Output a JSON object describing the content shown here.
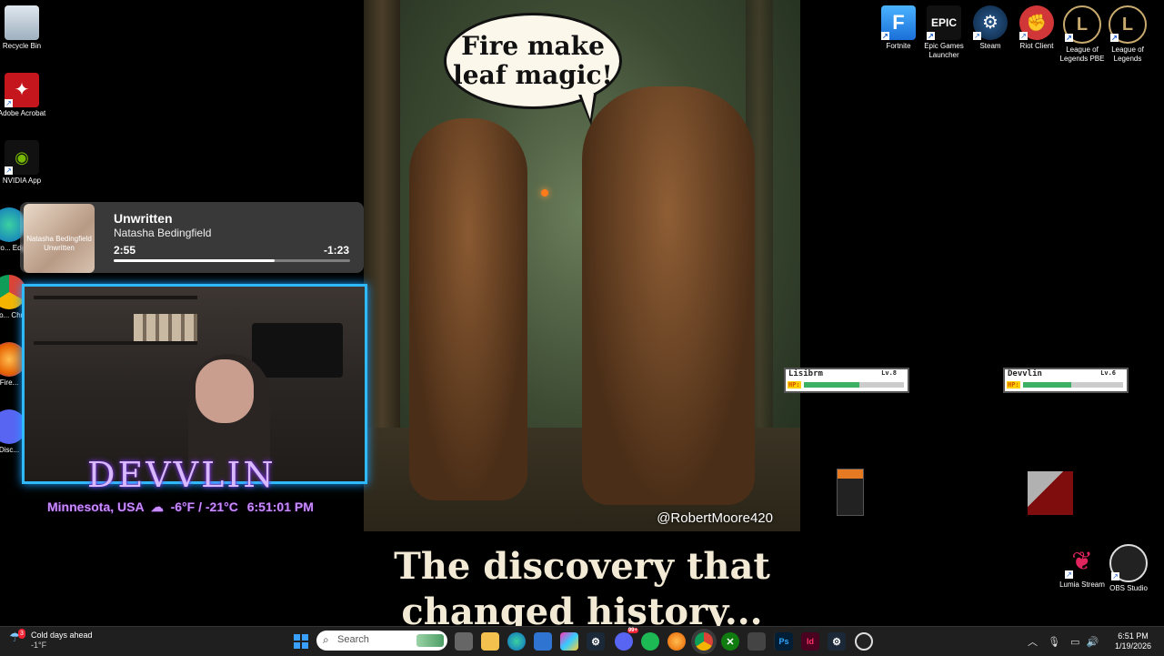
{
  "desktop_left": [
    {
      "label": "Recycle Bin"
    },
    {
      "label": "Adobe Acrobat"
    },
    {
      "label": "NVIDIA App"
    },
    {
      "label": "Micro... Edg..."
    },
    {
      "label": "Goo... Chr..."
    },
    {
      "label": "Fire..."
    },
    {
      "label": "Disc..."
    }
  ],
  "desktop_right": [
    {
      "label": "Fortnite",
      "glyph": "F"
    },
    {
      "label": "Epic Games Launcher",
      "glyph": "EPIC"
    },
    {
      "label": "Steam",
      "glyph": "⚙"
    },
    {
      "label": "Riot Client",
      "glyph": "✊"
    },
    {
      "label": "League of Legends PBE",
      "glyph": "L"
    },
    {
      "label": "League of Legends",
      "glyph": "L"
    }
  ],
  "desktop_bottom_right": [
    {
      "label": "Lumia Stream"
    },
    {
      "label": "OBS Studio"
    }
  ],
  "media": {
    "title": "Unwritten",
    "artist": "Natasha Bedingfield",
    "elapsed": "2:55",
    "remaining": "-1:23",
    "progress": 0.68,
    "art_text_1": "Natasha Bedingfield",
    "art_text_2": "Unwritten"
  },
  "meme": {
    "speech": "Fire make leaf magic!",
    "credit": "@RobertMoore420",
    "caption": "The discovery that changed history..."
  },
  "overlay": {
    "brand": "DEVVLIN",
    "location": "Minnesota, USA",
    "temp": "-6°F / -21°C",
    "time": "6:51:01 PM"
  },
  "hp_boxes": [
    {
      "name": "Lisibrm",
      "level": "Lv.8",
      "hp": 0.55
    },
    {
      "name": "Devvlin",
      "level": "Lv.6",
      "hp": 0.48
    }
  ],
  "taskbar": {
    "weather_title": "Cold days ahead",
    "weather_temp": "-1°F",
    "weather_badge": "3",
    "search_placeholder": "Search",
    "time": "6:51 PM",
    "date": "1/19/2026",
    "discord_badge": "99+"
  },
  "colors": {
    "accent_cam": "#2fb9ff",
    "brand_purple": "#c98cff",
    "hp_green": "#3cb063"
  }
}
